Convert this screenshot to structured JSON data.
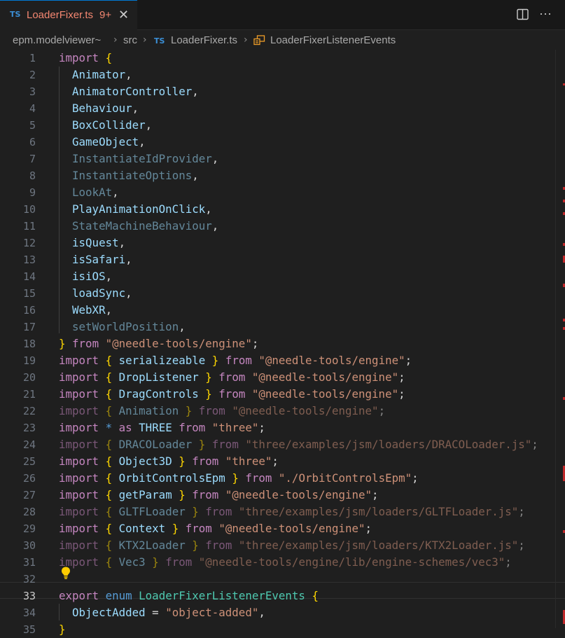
{
  "tab": {
    "lang_badge": "TS",
    "filename": "LoaderFixer.ts",
    "problems": "9+",
    "close_glyph": "✕"
  },
  "actions": {
    "split_editor_icon": "split-editor-icon",
    "more_glyph": "···"
  },
  "breadcrumb": {
    "root": "epm.modelviewer~",
    "folder": "src",
    "file_badge": "TS",
    "file": "LoaderFixer.ts",
    "symbol": "LoaderFixerListenerEvents"
  },
  "editor": {
    "line_numbers": [
      "1",
      "2",
      "3",
      "4",
      "5",
      "6",
      "7",
      "8",
      "9",
      "10",
      "11",
      "12",
      "13",
      "14",
      "15",
      "16",
      "17",
      "18",
      "19",
      "20",
      "21",
      "22",
      "23",
      "24",
      "25",
      "26",
      "27",
      "28",
      "29",
      "30",
      "31",
      "32",
      "33",
      "34",
      "35"
    ],
    "active_line": "33"
  },
  "colors": {
    "keyword": "#c586c0",
    "string": "#ce9178",
    "variable": "#9cdcfe",
    "brace": "#ffd700",
    "type": "#4ec9b0",
    "error_tab": "#f48771",
    "ts_badge": "#3b8fd6"
  }
}
